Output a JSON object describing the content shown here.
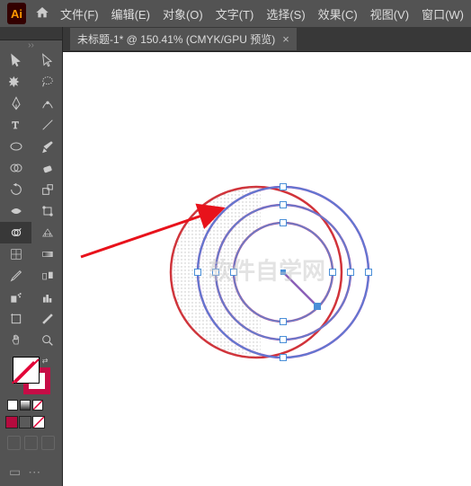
{
  "app": {
    "logo": "Ai"
  },
  "menu": {
    "file": "文件(F)",
    "edit": "编辑(E)",
    "object": "对象(O)",
    "type": "文字(T)",
    "select": "选择(S)",
    "effect": "效果(C)",
    "view": "视图(V)",
    "window": "窗口(W)"
  },
  "document": {
    "tab_label": "未标题-1* @ 150.41% (CMYK/GPU 预览)"
  },
  "watermark": "软件自学网",
  "colors": {
    "stroke": "#c60c46",
    "swatch1": "#b50b3e",
    "swatch2": "#5a5a5a",
    "swatch3": "#ffffff"
  },
  "chart_data": {
    "type": "vector-artwork",
    "description": "Concentric circles with red outer ring and purple/violet gradient rings, partially selected with blue anchor points, left half showing dotted selection pattern"
  }
}
